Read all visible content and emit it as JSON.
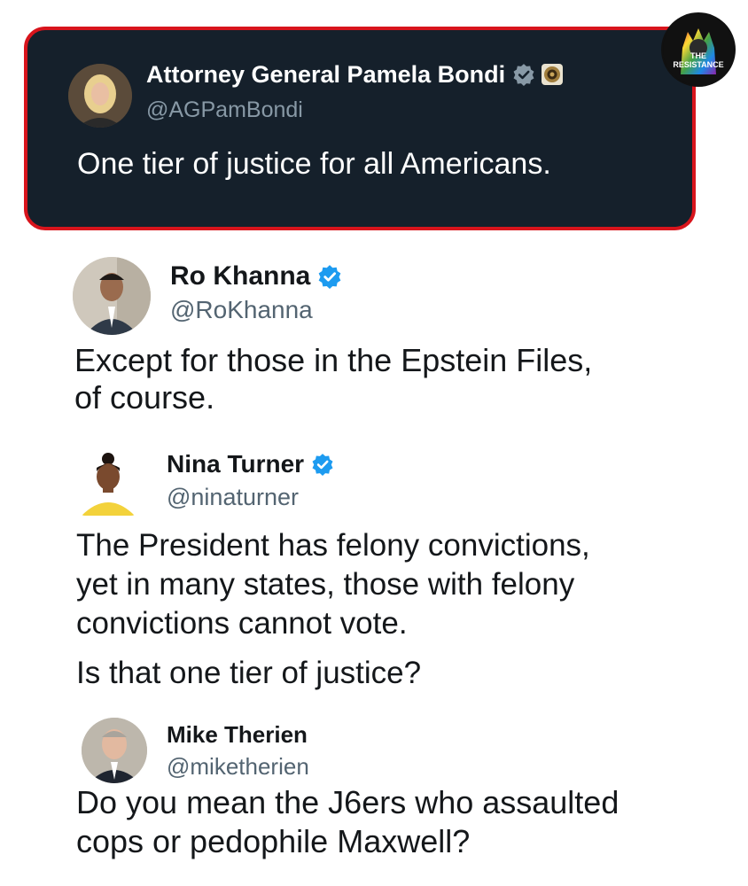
{
  "watermark": {
    "line1": "THE",
    "line2": "RESISTANCE"
  },
  "tweets": [
    {
      "name": "Attorney General Pamela Bondi",
      "handle": "@AGPamBondi",
      "text": [
        "One tier of justice for all Americans."
      ],
      "verified_color": "#8899a6",
      "avatar_icon": "person-portrait-icon"
    },
    {
      "name": "Ro Khanna",
      "handle": "@RoKhanna",
      "text": [
        "Except for those in the Epstein Files,",
        "of course."
      ],
      "verified_color": "#1d9bf0",
      "avatar_icon": "person-portrait-icon"
    },
    {
      "name": "Nina Turner",
      "handle": "@ninaturner",
      "text": [
        "The President has felony convictions,",
        "yet in many states, those with felony",
        "convictions cannot vote."
      ],
      "text2": "Is that one tier of justice?",
      "verified_color": "#1d9bf0",
      "avatar_icon": "person-portrait-icon"
    },
    {
      "name": "Mike Therien",
      "handle": "@miketherien",
      "text": [
        "Do you mean the J6ers who assaulted",
        "cops or pedophile Maxwell?"
      ],
      "avatar_icon": "person-portrait-icon"
    }
  ],
  "colors": {
    "card_bg": "#15202b",
    "card_border": "#d8141c",
    "verified_blue": "#1d9bf0"
  }
}
